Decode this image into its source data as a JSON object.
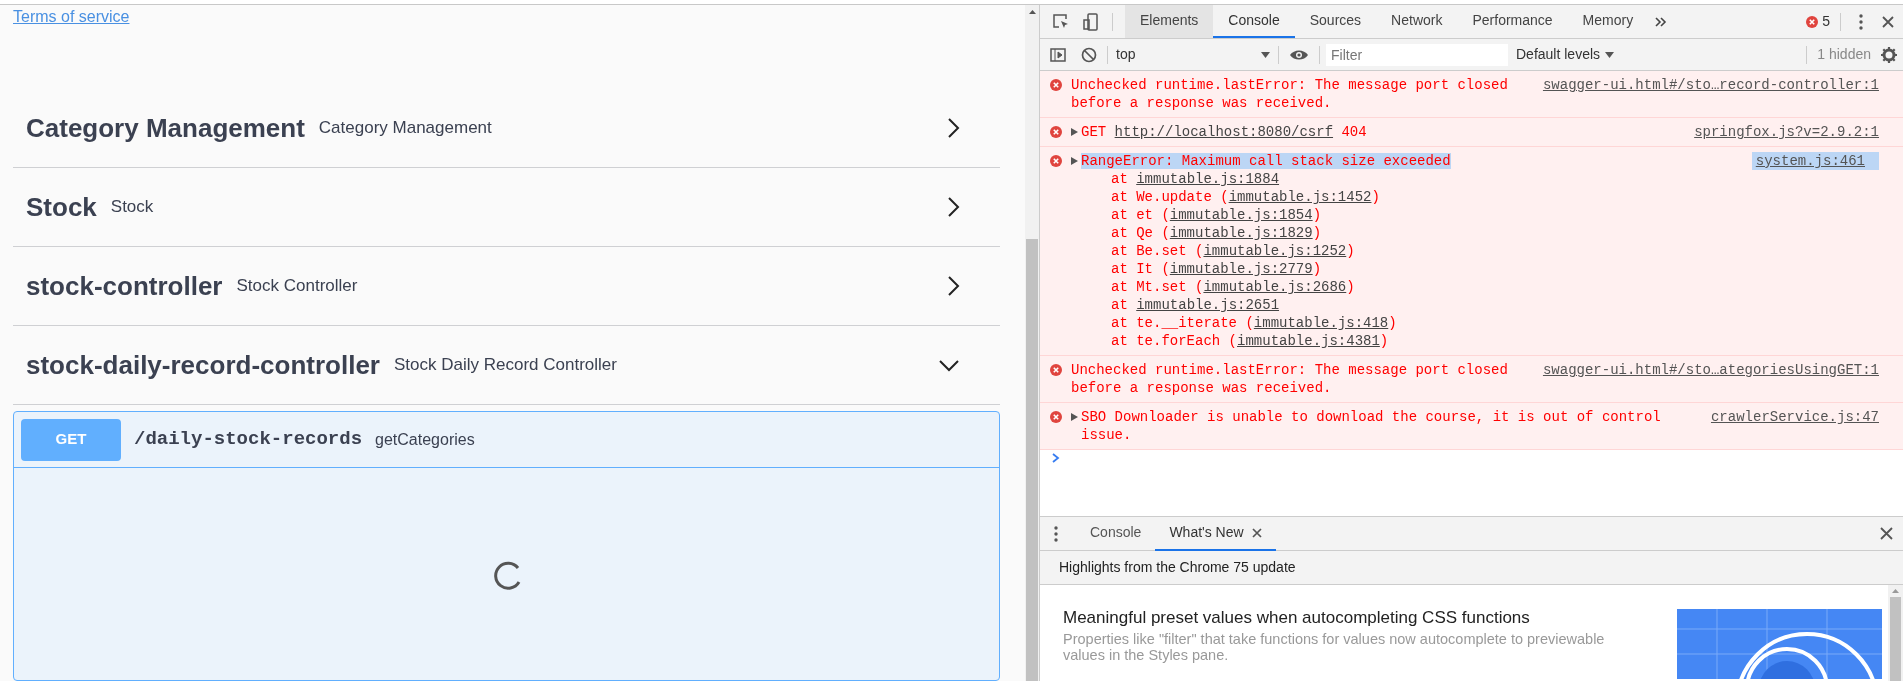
{
  "page": {
    "terms_link": "Terms of service",
    "tags": [
      {
        "name": "Category Management",
        "description": "Category Management",
        "expanded": false
      },
      {
        "name": "Stock",
        "description": "Stock",
        "expanded": false
      },
      {
        "name": "stock-controller",
        "description": "Stock Controller",
        "expanded": false
      },
      {
        "name": "stock-daily-record-controller",
        "description": "Stock Daily Record Controller",
        "expanded": true
      }
    ],
    "operation": {
      "method": "GET",
      "path": "/daily-stock-records",
      "summary": "getCategories",
      "loading": true
    }
  },
  "devtools": {
    "tabs": [
      {
        "label": "Elements",
        "selected": false,
        "hovered": true
      },
      {
        "label": "Console",
        "selected": true,
        "hovered": false
      },
      {
        "label": "Sources",
        "selected": false,
        "hovered": false
      },
      {
        "label": "Network",
        "selected": false,
        "hovered": false
      },
      {
        "label": "Performance",
        "selected": false,
        "hovered": false
      },
      {
        "label": "Memory",
        "selected": false,
        "hovered": false
      }
    ],
    "error_count": "5",
    "context": "top",
    "filter_placeholder": "Filter",
    "levels": "Default levels",
    "hidden": "1 hidden",
    "messages": [
      {
        "kind": "error",
        "expandable": false,
        "highlighted": false,
        "text": "Unchecked runtime.lastError: The message port closed before a response was received.",
        "source": "swagger-ui.html#/sto…record-controller:1"
      },
      {
        "kind": "network",
        "expandable": true,
        "highlighted": false,
        "prefix": "GET ",
        "url": "http://localhost:8080/csrf",
        "suffix": " 404",
        "source": "springfox.js?v=2.9.2:1"
      },
      {
        "kind": "error",
        "expandable": true,
        "highlighted": true,
        "text": "RangeError: Maximum call stack size exceeded",
        "source": "system.js:461",
        "stack": [
          {
            "prefix": "at ",
            "loc": "immutable.js:1884"
          },
          {
            "prefix": "at We.update (",
            "loc": "immutable.js:1452",
            "suffix": ")"
          },
          {
            "prefix": "at et (",
            "loc": "immutable.js:1854",
            "suffix": ")"
          },
          {
            "prefix": "at Qe (",
            "loc": "immutable.js:1829",
            "suffix": ")"
          },
          {
            "prefix": "at Be.set (",
            "loc": "immutable.js:1252",
            "suffix": ")"
          },
          {
            "prefix": "at It (",
            "loc": "immutable.js:2779",
            "suffix": ")"
          },
          {
            "prefix": "at Mt.set (",
            "loc": "immutable.js:2686",
            "suffix": ")"
          },
          {
            "prefix": "at ",
            "loc": "immutable.js:2651"
          },
          {
            "prefix": "at te.__iterate (",
            "loc": "immutable.js:418",
            "suffix": ")"
          },
          {
            "prefix": "at te.forEach (",
            "loc": "immutable.js:4381",
            "suffix": ")"
          }
        ]
      },
      {
        "kind": "error",
        "expandable": false,
        "highlighted": false,
        "text": "Unchecked runtime.lastError: The message port closed before a response was received.",
        "source": "swagger-ui.html#/sto…ategoriesUsingGET:1"
      },
      {
        "kind": "error",
        "expandable": true,
        "highlighted": false,
        "text": "SBO Downloader is unable to download the course, it is out of control issue.",
        "source": "crawlerService.js:47"
      }
    ],
    "drawer": {
      "tabs": [
        {
          "label": "Console",
          "selected": false,
          "closable": false
        },
        {
          "label": "What's New",
          "selected": true,
          "closable": true
        }
      ],
      "heading": "Highlights from the Chrome 75 update",
      "feature": {
        "title": "Meaningful preset values when autocompleting CSS functions",
        "description": "Properties like \"filter\" that take functions for values now autocomplete to previewable values in the Styles pane."
      }
    }
  }
}
